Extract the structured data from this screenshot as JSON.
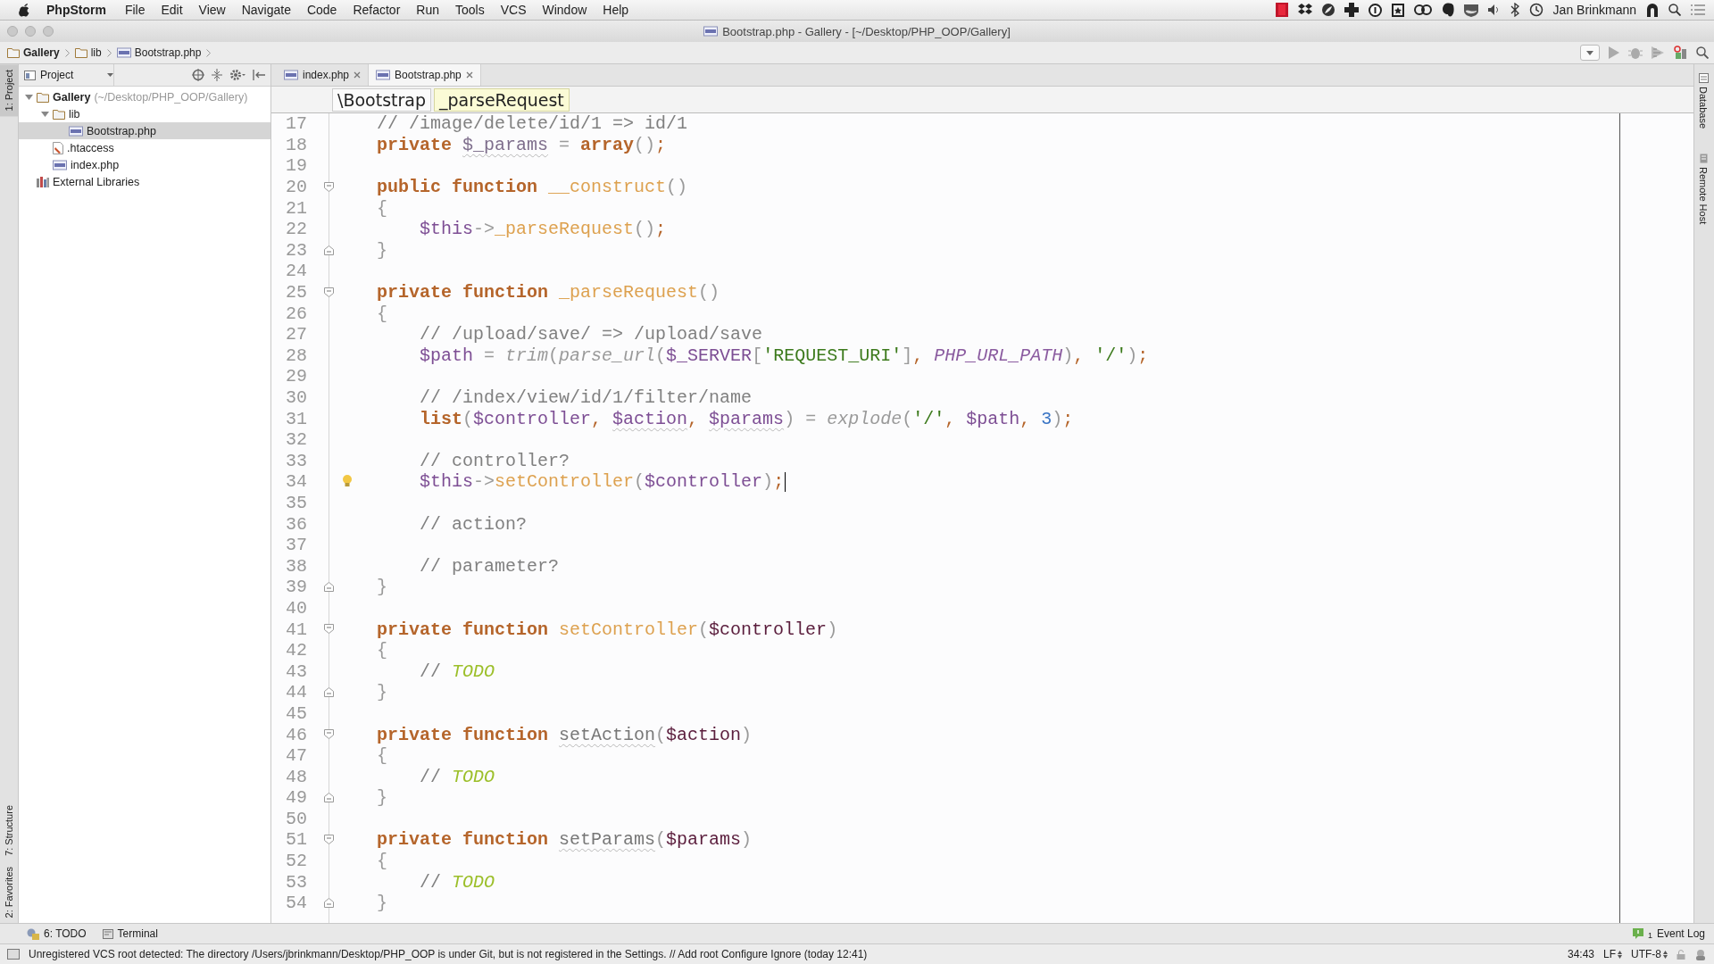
{
  "menubar": {
    "app_name": "PhpStorm",
    "menus": [
      "File",
      "Edit",
      "View",
      "Navigate",
      "Code",
      "Refactor",
      "Run",
      "Tools",
      "VCS",
      "Window",
      "Help"
    ],
    "user": "Jan Brinkmann"
  },
  "window": {
    "title": "Bootstrap.php - Gallery - [~/Desktop/PHP_OOP/Gallery]"
  },
  "nav_bar": [
    {
      "label": "Gallery",
      "kind": "folder"
    },
    {
      "label": "lib",
      "kind": "folder"
    },
    {
      "label": "Bootstrap.php",
      "kind": "php"
    }
  ],
  "left_strip": {
    "top": [
      {
        "label": "1: Project",
        "selected": true
      }
    ],
    "bottom": [
      {
        "label": "7: Structure",
        "selected": false
      },
      {
        "label": "2: Favorites",
        "selected": false
      }
    ]
  },
  "project_panel": {
    "title": "Project"
  },
  "project_tree": [
    {
      "label": "Gallery",
      "path": "(~/Desktop/PHP_OOP/Gallery)",
      "kind": "project",
      "expanded": true,
      "selected": false,
      "children": [
        {
          "label": "lib",
          "kind": "folder",
          "expanded": true,
          "selected": false,
          "children": [
            {
              "label": "Bootstrap.php",
              "kind": "php",
              "selected": true
            }
          ]
        },
        {
          "label": ".htaccess",
          "kind": "config",
          "selected": false
        },
        {
          "label": "index.php",
          "kind": "php",
          "selected": false
        }
      ]
    },
    {
      "label": "External Libraries",
      "kind": "library",
      "selected": false
    }
  ],
  "tabs": [
    {
      "label": "index.php",
      "selected": false
    },
    {
      "label": "Bootstrap.php",
      "selected": true
    }
  ],
  "breadcrumbs": [
    {
      "label": "\\Bootstrap",
      "selected": false
    },
    {
      "label": "_parseRequest",
      "selected": true
    }
  ],
  "code_lines": [
    {
      "number": "17",
      "kind": "member",
      "tokens": [
        {
          "kind": "comment",
          "text": "// /image/delete/id/1 => id/1"
        }
      ]
    },
    {
      "number": "18",
      "kind": "member",
      "tokens": [
        {
          "kind": "kw",
          "text": "private "
        },
        {
          "kind": "field",
          "text": "$_params",
          "warn": true
        },
        {
          "kind": "punct",
          "text": " = "
        },
        {
          "kind": "kw",
          "text": "array"
        },
        {
          "kind": "punct",
          "text": "()"
        },
        {
          "kind": "semi",
          "text": ";"
        }
      ]
    },
    {
      "number": "19"
    },
    {
      "number": "20",
      "fold_start": true,
      "kind": "member",
      "tokens": [
        {
          "kind": "kw",
          "text": "public "
        },
        {
          "kind": "kw",
          "text": "function "
        },
        {
          "kind": "fn",
          "text": "__construct"
        },
        {
          "kind": "punct",
          "text": "()"
        }
      ]
    },
    {
      "number": "21",
      "kind": "member",
      "tokens": [
        {
          "kind": "punct",
          "text": "{"
        }
      ]
    },
    {
      "number": "22",
      "kind": "body",
      "tokens": [
        {
          "kind": "var",
          "text": "$this"
        },
        {
          "kind": "punct",
          "text": "->"
        },
        {
          "kind": "fn",
          "text": "_parseRequest"
        },
        {
          "kind": "punct",
          "text": "()"
        },
        {
          "kind": "semi",
          "text": ";"
        }
      ]
    },
    {
      "number": "23",
      "fold_end": true,
      "kind": "member",
      "tokens": [
        {
          "kind": "punct",
          "text": "}"
        }
      ]
    },
    {
      "number": "24"
    },
    {
      "number": "25",
      "fold_start": true,
      "kind": "member",
      "tokens": [
        {
          "kind": "kw",
          "text": "private "
        },
        {
          "kind": "kw",
          "text": "function "
        },
        {
          "kind": "fn",
          "text": "_parseRequest"
        },
        {
          "kind": "punct",
          "text": "()"
        }
      ]
    },
    {
      "number": "26",
      "kind": "member",
      "tokens": [
        {
          "kind": "punct",
          "text": "{"
        }
      ]
    },
    {
      "number": "27",
      "kind": "body",
      "tokens": [
        {
          "kind": "comment",
          "text": "// /upload/save/ => /upload/save"
        }
      ]
    },
    {
      "number": "28",
      "kind": "body",
      "tokens": [
        {
          "kind": "var",
          "text": "$path"
        },
        {
          "kind": "punct",
          "text": " = "
        },
        {
          "kind": "builtin",
          "text": "trim"
        },
        {
          "kind": "punct",
          "text": "("
        },
        {
          "kind": "builtin",
          "text": "parse_url"
        },
        {
          "kind": "punct",
          "text": "("
        },
        {
          "kind": "var",
          "text": "$_SERVER"
        },
        {
          "kind": "punct",
          "text": "["
        },
        {
          "kind": "str",
          "text": "'REQUEST_URI'"
        },
        {
          "kind": "punct",
          "text": "]"
        },
        {
          "kind": "semi",
          "text": ", "
        },
        {
          "kind": "const",
          "text": "PHP_URL_PATH"
        },
        {
          "kind": "punct",
          "text": ")"
        },
        {
          "kind": "semi",
          "text": ", "
        },
        {
          "kind": "str",
          "text": "'/'"
        },
        {
          "kind": "punct",
          "text": ")"
        },
        {
          "kind": "semi",
          "text": ";"
        }
      ]
    },
    {
      "number": "29"
    },
    {
      "number": "30",
      "kind": "body",
      "tokens": [
        {
          "kind": "comment",
          "text": "// /index/view/id/1/filter/name"
        }
      ]
    },
    {
      "number": "31",
      "kind": "body",
      "tokens": [
        {
          "kind": "kw",
          "text": "list"
        },
        {
          "kind": "punct",
          "text": "("
        },
        {
          "kind": "var",
          "text": "$controller"
        },
        {
          "kind": "semi",
          "text": ", "
        },
        {
          "kind": "var",
          "text": "$action",
          "warn": true
        },
        {
          "kind": "semi",
          "text": ", "
        },
        {
          "kind": "var",
          "text": "$params",
          "warn": true
        },
        {
          "kind": "punct",
          "text": ") = "
        },
        {
          "kind": "builtin",
          "text": "explode"
        },
        {
          "kind": "punct",
          "text": "("
        },
        {
          "kind": "str",
          "text": "'/'"
        },
        {
          "kind": "semi",
          "text": ", "
        },
        {
          "kind": "var",
          "text": "$path"
        },
        {
          "kind": "semi",
          "text": ", "
        },
        {
          "kind": "num",
          "text": "3"
        },
        {
          "kind": "punct",
          "text": ")"
        },
        {
          "kind": "semi",
          "text": ";"
        }
      ]
    },
    {
      "number": "32"
    },
    {
      "number": "33",
      "kind": "body",
      "tokens": [
        {
          "kind": "comment",
          "text": "// controller?"
        }
      ]
    },
    {
      "number": "34",
      "bulb": true,
      "caret": true,
      "kind": "body",
      "tokens": [
        {
          "kind": "var",
          "text": "$this"
        },
        {
          "kind": "punct",
          "text": "->"
        },
        {
          "kind": "fn",
          "text": "setController"
        },
        {
          "kind": "punct",
          "text": "("
        },
        {
          "kind": "var",
          "text": "$controller"
        },
        {
          "kind": "punct",
          "text": ")"
        },
        {
          "kind": "semi",
          "text": ";"
        }
      ]
    },
    {
      "number": "35"
    },
    {
      "number": "36",
      "kind": "body",
      "tokens": [
        {
          "kind": "comment",
          "text": "// action?"
        }
      ]
    },
    {
      "number": "37"
    },
    {
      "number": "38",
      "kind": "body",
      "tokens": [
        {
          "kind": "comment",
          "text": "// parameter?"
        }
      ]
    },
    {
      "number": "39",
      "fold_end": true,
      "kind": "member",
      "tokens": [
        {
          "kind": "punct",
          "text": "}"
        }
      ]
    },
    {
      "number": "40"
    },
    {
      "number": "41",
      "fold_start": true,
      "kind": "member",
      "tokens": [
        {
          "kind": "kw",
          "text": "private "
        },
        {
          "kind": "kw",
          "text": "function "
        },
        {
          "kind": "fn",
          "text": "setController"
        },
        {
          "kind": "punct",
          "text": "("
        },
        {
          "kind": "param",
          "text": "$controller"
        },
        {
          "kind": "punct",
          "text": ")"
        }
      ]
    },
    {
      "number": "42",
      "kind": "member",
      "tokens": [
        {
          "kind": "punct",
          "text": "{"
        }
      ]
    },
    {
      "number": "43",
      "kind": "body",
      "tokens": [
        {
          "kind": "comment",
          "text": "// "
        },
        {
          "kind": "todo",
          "text": "TODO"
        }
      ]
    },
    {
      "number": "44",
      "fold_end": true,
      "kind": "member",
      "tokens": [
        {
          "kind": "punct",
          "text": "}"
        }
      ]
    },
    {
      "number": "45"
    },
    {
      "number": "46",
      "fold_start": true,
      "kind": "member",
      "tokens": [
        {
          "kind": "kw",
          "text": "private "
        },
        {
          "kind": "kw",
          "text": "function "
        },
        {
          "kind": "unused",
          "text": "setAction",
          "warn": true
        },
        {
          "kind": "punct",
          "text": "("
        },
        {
          "kind": "param",
          "text": "$action"
        },
        {
          "kind": "punct",
          "text": ")"
        }
      ]
    },
    {
      "number": "47",
      "kind": "member",
      "tokens": [
        {
          "kind": "punct",
          "text": "{"
        }
      ]
    },
    {
      "number": "48",
      "kind": "body",
      "tokens": [
        {
          "kind": "comment",
          "text": "// "
        },
        {
          "kind": "todo",
          "text": "TODO"
        }
      ]
    },
    {
      "number": "49",
      "fold_end": true,
      "kind": "member",
      "tokens": [
        {
          "kind": "punct",
          "text": "}"
        }
      ]
    },
    {
      "number": "50"
    },
    {
      "number": "51",
      "fold_start": true,
      "kind": "member",
      "tokens": [
        {
          "kind": "kw",
          "text": "private "
        },
        {
          "kind": "kw",
          "text": "function "
        },
        {
          "kind": "unused",
          "text": "setParams",
          "warn": true
        },
        {
          "kind": "punct",
          "text": "("
        },
        {
          "kind": "param",
          "text": "$params"
        },
        {
          "kind": "punct",
          "text": ")"
        }
      ]
    },
    {
      "number": "52",
      "kind": "member",
      "tokens": [
        {
          "kind": "punct",
          "text": "{"
        }
      ]
    },
    {
      "number": "53",
      "kind": "body",
      "tokens": [
        {
          "kind": "comment",
          "text": "// "
        },
        {
          "kind": "todo",
          "text": "TODO"
        }
      ]
    },
    {
      "number": "54",
      "fold_end": true,
      "kind": "member",
      "tokens": [
        {
          "kind": "punct",
          "text": "}"
        }
      ]
    }
  ],
  "right_strip": [
    "Database",
    "Remote Host"
  ],
  "bottom_tools": [
    {
      "label": "6: TODO"
    },
    {
      "label": "Terminal"
    }
  ],
  "event_log": {
    "label": "Event Log",
    "count": "1"
  },
  "status_bar": {
    "message": "Unregistered VCS root detected: The directory /Users/jbrinkmann/Desktop/PHP_OOP is under Git, but is not registered in the Settings. // Add root  Configure  Ignore (today 12:41)",
    "position": "34:43",
    "line_separator": "LF",
    "encoding": "UTF-8"
  }
}
